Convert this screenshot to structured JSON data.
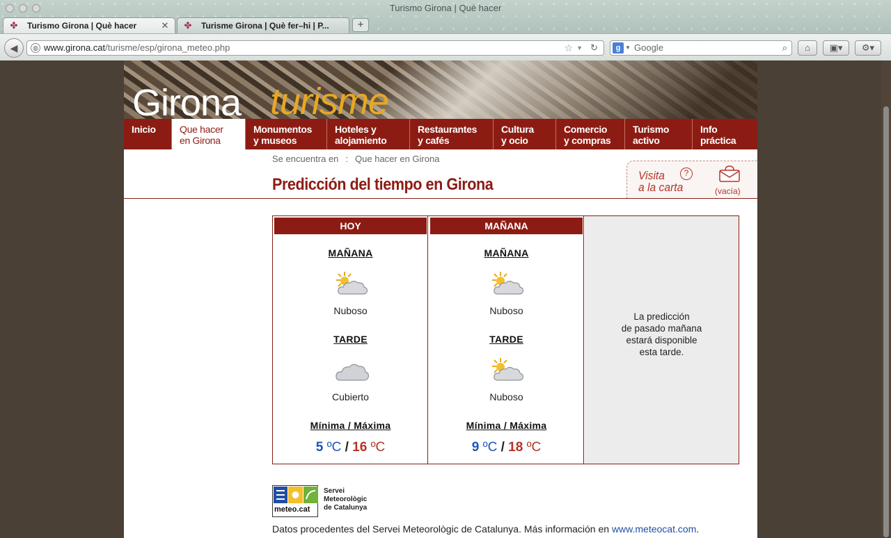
{
  "window": {
    "title": "Turismo Girona | Què hacer"
  },
  "tabs": [
    {
      "label": "Turismo Girona | Què hacer",
      "active": true
    },
    {
      "label": "Turisme Girona | Què fer–hi | P...",
      "active": false
    }
  ],
  "newtab_label": "+",
  "toolbar": {
    "url_host": "www.girona.cat",
    "url_path": "/turisme/esp/girona_meteo.php",
    "search_placeholder": "Google",
    "search_engine_letter": "g"
  },
  "site": {
    "brand_main": "Girona",
    "brand_sub": "turisme",
    "menu": [
      {
        "line1": "Inicio",
        "line2": "",
        "active": false
      },
      {
        "line1": "Que hacer",
        "line2": "en Girona",
        "active": true
      },
      {
        "line1": "Monumentos",
        "line2": "y museos",
        "active": false
      },
      {
        "line1": "Hoteles y",
        "line2": "alojamiento",
        "active": false
      },
      {
        "line1": "Restaurantes",
        "line2": "y cafés",
        "active": false
      },
      {
        "line1": "Cultura",
        "line2": "y ocio",
        "active": false
      },
      {
        "line1": "Comercio",
        "line2": "y compras",
        "active": false
      },
      {
        "line1": "Turismo",
        "line2": "activo",
        "active": false
      },
      {
        "line1": "Info",
        "line2": "práctica",
        "active": false
      }
    ],
    "breadcrumb": {
      "prefix": "Se encuentra en",
      "separator": ":",
      "current": "Que hacer en Girona"
    },
    "page_title": "Predicción del tiempo en Girona",
    "visita": {
      "line1": "Visita",
      "line2": "a la carta",
      "help": "?",
      "basket": "(vacía)"
    }
  },
  "weather": {
    "days": [
      {
        "header": "HOY",
        "morning_label": "MAÑANA",
        "morning_condition": "Nuboso",
        "morning_icon": "sun-cloud-icon",
        "afternoon_label": "TARDE",
        "afternoon_condition": "Cubierto",
        "afternoon_icon": "cloud-icon",
        "minmax_label": "Mínima / Máxima",
        "min": "5",
        "max": "16",
        "unit": "ºC",
        "slash": "/"
      },
      {
        "header": "MAÑANA",
        "morning_label": "MAÑANA",
        "morning_condition": "Nuboso",
        "morning_icon": "sun-cloud-icon",
        "afternoon_label": "TARDE",
        "afternoon_condition": "Nuboso",
        "afternoon_icon": "sun-cloud-icon",
        "minmax_label": "Mínima / Máxima",
        "min": "9",
        "max": "18",
        "unit": "ºC",
        "slash": "/"
      }
    ],
    "note_lines": [
      "La predicción",
      "de pasado mañana",
      "estará disponible",
      "esta tarde."
    ]
  },
  "meteocat": {
    "logo_text": "meteo.cat",
    "name_lines": [
      "Servei",
      "Meteorològic",
      "de Catalunya"
    ]
  },
  "footer": {
    "text": "Datos procedentes del Servei Meteorològic de Catalunya. Más información en ",
    "link": "www.meteocat.com",
    "end": "."
  },
  "colors": {
    "brand_red": "#8c1c13",
    "accent_orange": "#e8a822",
    "min_blue": "#1f55b8",
    "max_red": "#b4342a"
  }
}
